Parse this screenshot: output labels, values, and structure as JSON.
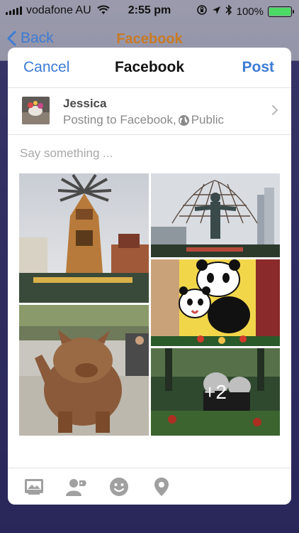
{
  "status": {
    "carrier": "vodafone AU",
    "time": "2:55 pm",
    "battery": "100%"
  },
  "background": {
    "back_label": "Back",
    "title": "Facebook"
  },
  "sheet": {
    "cancel_label": "Cancel",
    "title": "Facebook",
    "post_label": "Post",
    "account": {
      "name": "Jessica",
      "posting_to": "Posting to Facebook,",
      "audience": "Public"
    },
    "compose_placeholder": "Say something ...",
    "photos": [
      {
        "subject": "christmas pyramid tower"
      },
      {
        "subject": "statue with net"
      },
      {
        "subject": "bronze pig statue"
      },
      {
        "subject": "panda mural"
      },
      {
        "subject": "panda statues",
        "more_count": "+2"
      }
    ]
  },
  "toolbar": {
    "icons": [
      "photo-library-icon",
      "tag-people-icon",
      "emoji-icon",
      "location-pin-icon"
    ]
  },
  "colors": {
    "accent": "#3d7bd5",
    "title_orange": "#c97a26"
  }
}
